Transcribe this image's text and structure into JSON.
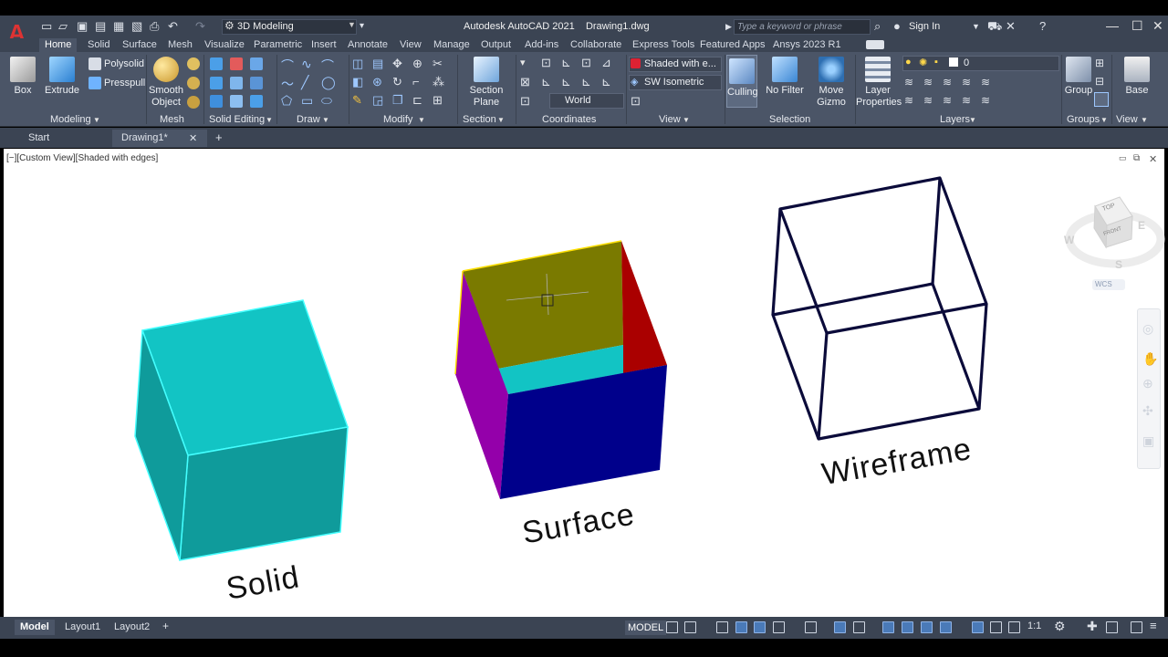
{
  "window": {
    "app_title": "Autodesk AutoCAD 2021",
    "file_name": "Drawing1.dwg",
    "workspace": "3D Modeling",
    "search_placeholder": "Type a keyword or phrase",
    "signin": "Sign In",
    "logo": "A"
  },
  "ribbon_tabs": [
    "Home",
    "Solid",
    "Surface",
    "Mesh",
    "Visualize",
    "Parametric",
    "Insert",
    "Annotate",
    "View",
    "Manage",
    "Output",
    "Add-ins",
    "Collaborate",
    "Express Tools",
    "Featured Apps",
    "Ansys  2023 R1"
  ],
  "ribbon": {
    "modeling": {
      "title": "Modeling",
      "box": "Box",
      "extrude": "Extrude",
      "polysolid": "Polysolid",
      "presspull": "Presspull"
    },
    "mesh": {
      "title": "Mesh",
      "smooth_object_line1": "Smooth",
      "smooth_object_line2": "Object"
    },
    "solid_editing": {
      "title": "Solid Editing"
    },
    "draw": {
      "title": "Draw"
    },
    "modify": {
      "title": "Modify"
    },
    "section": {
      "title": "Section",
      "section_plane_line1": "Section",
      "section_plane_line2": "Plane"
    },
    "coordinates": {
      "title": "Coordinates",
      "ucs": "World"
    },
    "view": {
      "title": "View",
      "visual_style": "Shaded with e...",
      "view_dir": "SW Isometric"
    },
    "selection": {
      "title": "Selection",
      "culling": "Culling",
      "no_filter": "No Filter",
      "move_gizmo_line1": "Move",
      "move_gizmo_line2": "Gizmo"
    },
    "layers": {
      "title": "Layers",
      "layer_properties_line1": "Layer",
      "layer_properties_line2": "Properties",
      "current_layer": "0"
    },
    "groups": {
      "title": "Groups",
      "group": "Group"
    },
    "view2": {
      "title": "View",
      "base": "Base"
    }
  },
  "doc_tabs": {
    "start": "Start",
    "drawing": "Drawing1*",
    "add": "+"
  },
  "viewport": {
    "label": "[−][Custom View][Shaded with edges]",
    "labels": {
      "solid": "Solid",
      "surface": "Surface",
      "wireframe": "Wireframe"
    },
    "viewcube": {
      "top": "TOP",
      "front": "FRONT",
      "west": "W",
      "east": "E",
      "south": "S",
      "wcs": "WCS"
    }
  },
  "statusbar": {
    "layouts": [
      "Model",
      "Layout1",
      "Layout2"
    ],
    "add": "+",
    "model_space": "MODEL",
    "scale": "1:1"
  },
  "colors": {
    "solid_top": "#12c4c4",
    "solid_front": "#0f9b9b",
    "surface_back": "#7a7a00",
    "surface_left": "#9400aa",
    "surface_right": "#aa0000",
    "surface_front": "#00008b",
    "surface_inner": "#12c4c4",
    "wire": "#0b0b3a"
  }
}
